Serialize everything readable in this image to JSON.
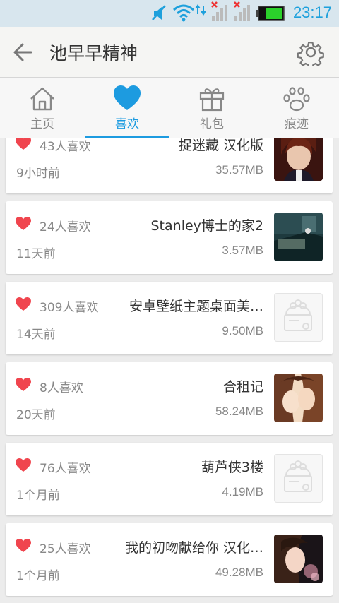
{
  "status_bar": {
    "time": "23:17",
    "icons": [
      "mute-icon",
      "wifi-icon",
      "signal-x-icon",
      "signal-x-icon",
      "battery-icon"
    ]
  },
  "header": {
    "back_icon": "back-arrow-icon",
    "title": "池早早精神",
    "settings_icon": "gear-icon"
  },
  "tabs": [
    {
      "label": "主页",
      "icon": "home-icon",
      "active": false
    },
    {
      "label": "喜欢",
      "icon": "heart-icon",
      "active": true
    },
    {
      "label": "礼包",
      "icon": "gift-icon",
      "active": false
    },
    {
      "label": "痕迹",
      "icon": "paw-icon",
      "active": false
    }
  ],
  "colors": {
    "accent": "#1d9be0",
    "heart": "#f0454e",
    "text_primary": "#333333",
    "text_secondary": "#888888"
  },
  "items": [
    {
      "likes": "43人喜欢",
      "name": "捉迷藏 汉化版",
      "age": "9小时前",
      "size": "35.57MB",
      "thumb": "anime-portrait"
    },
    {
      "likes": "24人喜欢",
      "name": "Stanley博士的家2",
      "age": "11天前",
      "size": "3.57MB",
      "thumb": "game-room"
    },
    {
      "likes": "309人喜欢",
      "name": "安卓壁纸主题桌面美…",
      "age": "14天前",
      "size": "9.50MB",
      "thumb": "placeholder"
    },
    {
      "likes": "8人喜欢",
      "name": "合租记",
      "age": "20天前",
      "size": "58.24MB",
      "thumb": "anime-kiss"
    },
    {
      "likes": "76人喜欢",
      "name": "葫芦侠3楼",
      "age": "1个月前",
      "size": "4.19MB",
      "thumb": "placeholder"
    },
    {
      "likes": "25人喜欢",
      "name": "我的初吻献给你 汉化…",
      "age": "1个月前",
      "size": "49.28MB",
      "thumb": "anime-girl"
    }
  ]
}
